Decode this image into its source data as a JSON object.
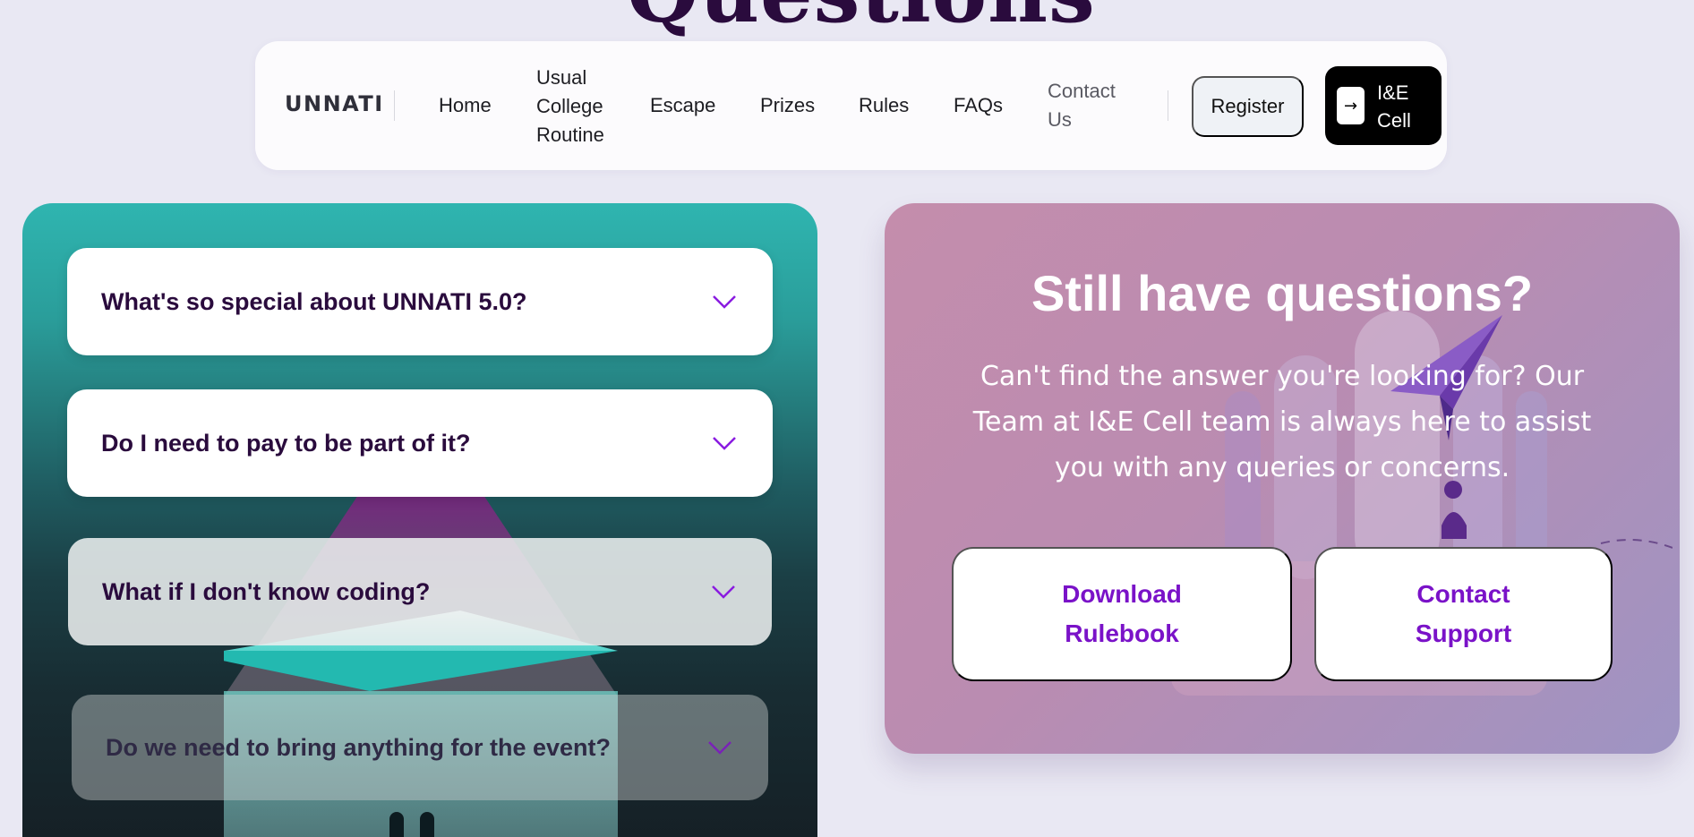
{
  "background_heading": "Questions",
  "nav": {
    "logo": "UNNATI",
    "links": [
      "Home",
      "Usual College Routine",
      "Escape",
      "Prizes",
      "Rules",
      "FAQs",
      "Contact Us"
    ],
    "register_label": "Register",
    "cta_label": "I&E Cell"
  },
  "faq": {
    "items": [
      "What's so special about UNNATI 5.0?",
      "Do I need to pay to be part of it?",
      "What if I don't know coding?",
      "Do we need to bring anything for the event?"
    ]
  },
  "help": {
    "title": "Still have questions?",
    "text": "Can't find the answer you're looking for? Our Team at I&E Cell team is always here to assist you with any queries or concerns.",
    "download_label": "Download Rulebook",
    "contact_label": "Contact Support"
  },
  "colors": {
    "accent": "#7a12c8",
    "heading": "#2a0b3d",
    "chevron": "#8a1be0"
  }
}
